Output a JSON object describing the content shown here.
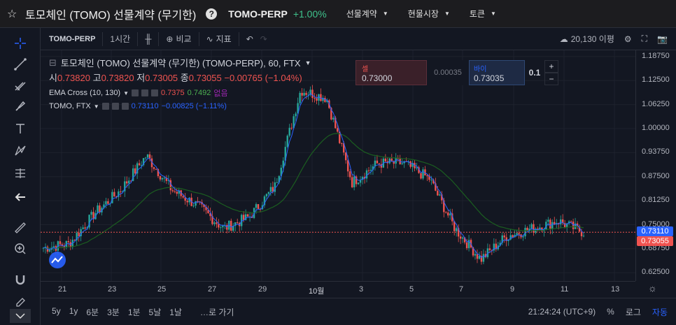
{
  "header": {
    "title": "토모체인 (TOMO) 선물계약 (무기한)",
    "symbol": "TOMO-PERP",
    "change": "+1.00%",
    "menus": [
      "선물계약",
      "현물시장",
      "토큰"
    ]
  },
  "toolbar": {
    "symbol": "TOMO-PERP",
    "interval": "1시간",
    "compare": "비교",
    "indicators": "지표",
    "ideas_count": "20,130 이평"
  },
  "legend": {
    "title": "토모체인 (TOMO) 선물계약 (무기한) (TOMO-PERP), 60, FTX",
    "ohlc": [
      {
        "label": "시",
        "value": "0.73820"
      },
      {
        "label": "고",
        "value": "0.73820"
      },
      {
        "label": "저",
        "value": "0.73005"
      },
      {
        "label": "종",
        "value": "0.73055"
      }
    ],
    "delta": "−0.00765 (−1.04%)",
    "indicator1": {
      "name": "EMA Cross (10, 130)",
      "v1": "0.7375",
      "v2": "0.7492",
      "v3": "없음"
    },
    "indicator2": {
      "name": "TOMO, FTX",
      "v1": "0.73110",
      "v2": "−0.00825 (−1.11%)"
    }
  },
  "order": {
    "sell_label": "셀",
    "sell_price": "0.73000",
    "spread": "0.00035",
    "buy_label": "바이",
    "buy_price": "0.73035",
    "quantity": "0.1",
    "plus": "+",
    "minus": "−"
  },
  "price_axis": [
    "1.18750",
    "1.12500",
    "1.06250",
    "1.00000",
    "0.93750",
    "0.87500",
    "0.81250",
    "0.75000",
    "0.68750",
    "0.62500"
  ],
  "price_tags": {
    "blue": "0.73110",
    "red": "0.73055"
  },
  "time_axis": [
    "21",
    "23",
    "25",
    "27",
    "29",
    "10월",
    "3",
    "5",
    "7",
    "9",
    "11",
    "13"
  ],
  "bottom": {
    "ranges": [
      "5y",
      "1y",
      "6분",
      "3분",
      "1분",
      "5날",
      "1날"
    ],
    "goto": "…로 가기",
    "time": "21:24:24 (UTC+9)",
    "percent": "%",
    "log": "로그",
    "auto": "자동"
  },
  "colors": {
    "up": "#26a69a",
    "down": "#ef5350",
    "ema_fast": "#e91e63",
    "ema_slow": "#1b5e20",
    "accent": "#2962ff"
  },
  "chart_data": {
    "type": "line",
    "title": "토모체인 (TOMO) 선물계약 (무기한) (TOMO-PERP), 60, FTX",
    "x": [
      "21",
      "22",
      "23",
      "24",
      "25",
      "26",
      "27",
      "28",
      "29",
      "30",
      "10월",
      "2",
      "3",
      "4",
      "5",
      "6",
      "7",
      "8",
      "9",
      "10",
      "11",
      "12"
    ],
    "series": [
      {
        "name": "TOMO-PERP",
        "values": [
          0.69,
          0.7,
          0.78,
          0.84,
          0.93,
          0.84,
          0.8,
          0.74,
          0.77,
          0.85,
          1.1,
          1.08,
          0.86,
          0.91,
          0.91,
          0.87,
          0.74,
          0.66,
          0.72,
          0.74,
          0.76,
          0.73
        ]
      }
    ],
    "ylim": [
      0.6,
      1.2
    ]
  }
}
